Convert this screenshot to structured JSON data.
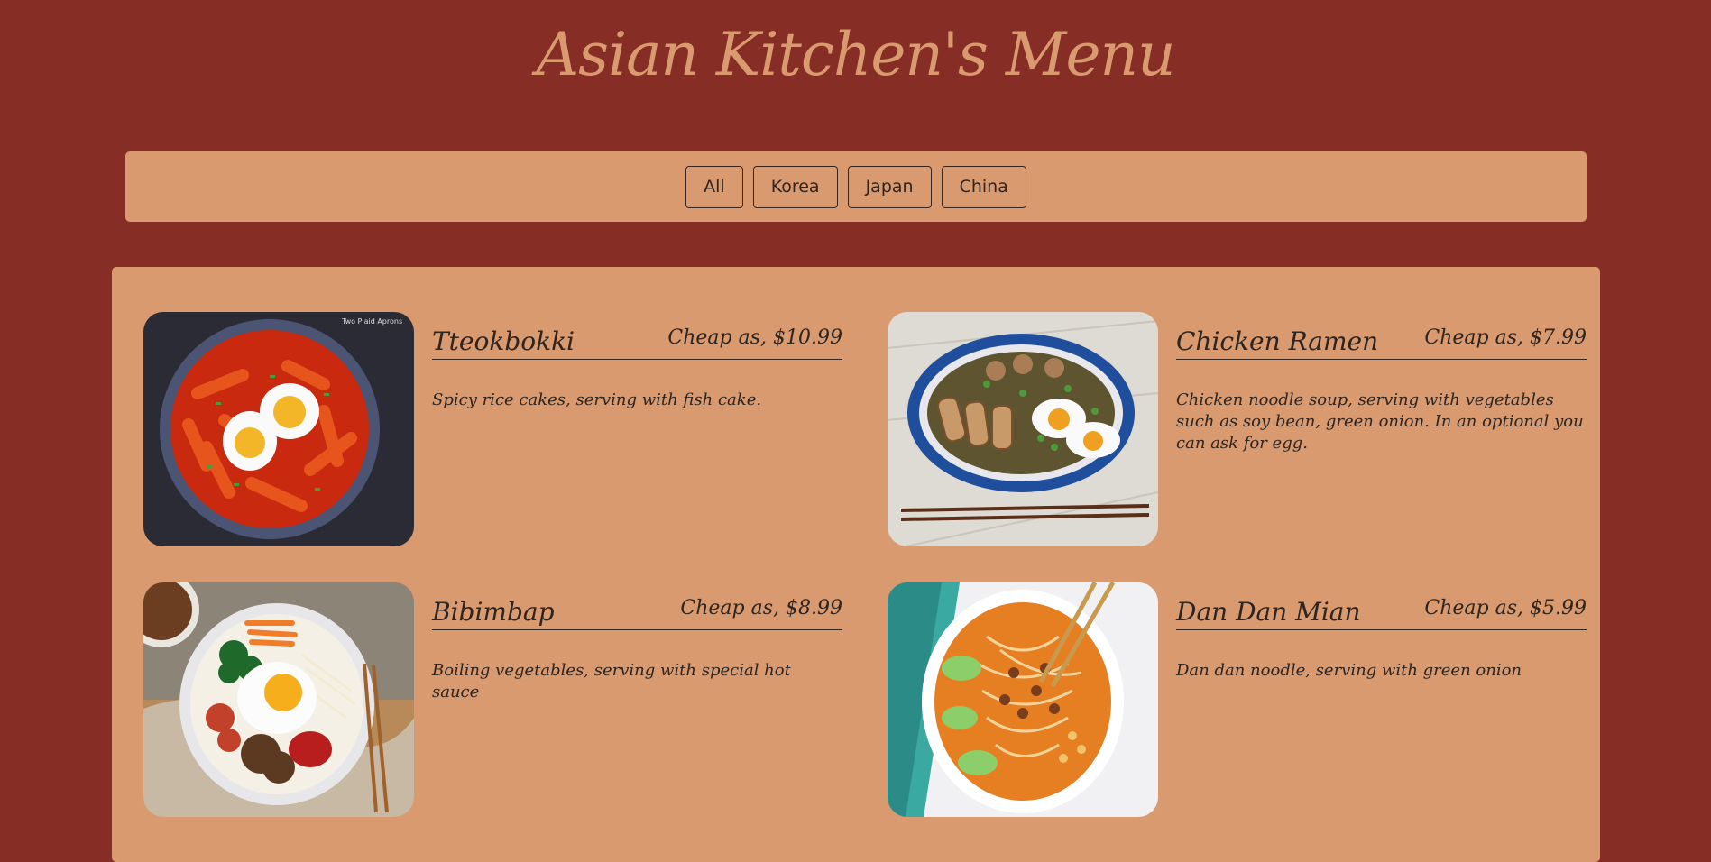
{
  "header": {
    "title": "Asian Kitchen's Menu"
  },
  "filters": {
    "labels": [
      "All",
      "Korea",
      "Japan",
      "China"
    ]
  },
  "colors": {
    "background": "#862d25",
    "panel": "#d99a6f",
    "title": "#da9a6f",
    "text": "#2e2420"
  },
  "menu": {
    "items": [
      {
        "name": "Tteokbokki",
        "price": "Cheap as, $10.99",
        "description": "Spicy rice cakes, serving with fish cake.",
        "photo_caption": "Two Plaid Aprons"
      },
      {
        "name": "Chicken Ramen",
        "price": "Cheap as, $7.99",
        "description": "Chicken noodle soup, serving with vegetables such as soy bean, green onion. In an optional you can ask for egg."
      },
      {
        "name": "Bibimbap",
        "price": "Cheap as, $8.99",
        "description": "Boiling vegetables, serving with special hot sauce"
      },
      {
        "name": "Dan Dan Mian",
        "price": "Cheap as, $5.99",
        "description": "Dan dan noodle, serving with green onion"
      }
    ]
  }
}
